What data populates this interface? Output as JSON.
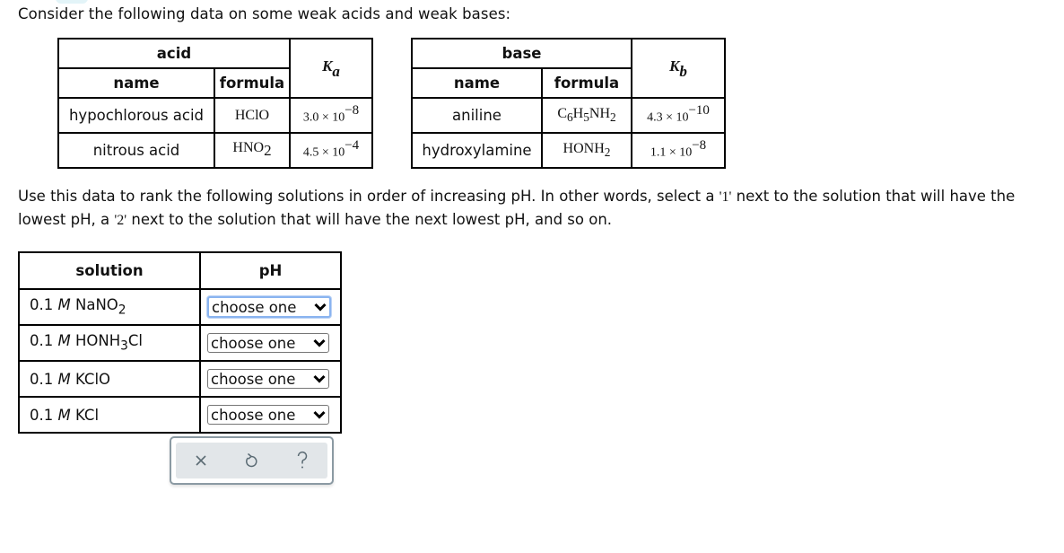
{
  "intro_text": "Consider the following data on some weak acids and weak bases:",
  "acid_table": {
    "group_header": "acid",
    "name_header": "name",
    "formula_header": "formula",
    "k_symbol": "K",
    "k_subscript": "a",
    "rows": [
      {
        "name": "hypochlorous acid",
        "formula": "HClO",
        "formula_sub": "",
        "k_mantissa": "3.0 × 10",
        "k_exponent": "−8"
      },
      {
        "name": "nitrous acid",
        "formula": "HNO",
        "formula_sub": "2",
        "k_mantissa": "4.5 × 10",
        "k_exponent": "−4"
      }
    ]
  },
  "base_table": {
    "group_header": "base",
    "name_header": "name",
    "formula_header": "formula",
    "k_symbol": "K",
    "k_subscript": "b",
    "rows": [
      {
        "name": "aniline",
        "formula_parts": [
          "C",
          "6",
          "H",
          "5",
          "NH",
          "2"
        ],
        "k_mantissa": "4.3 × 10",
        "k_exponent": "−10"
      },
      {
        "name": "hydroxylamine",
        "formula_parts": [
          "HONH",
          "2"
        ],
        "k_mantissa": "1.1 × 10",
        "k_exponent": "−8"
      }
    ]
  },
  "prompt": {
    "part1": "Use this data to rank the following solutions in order of increasing pH. In other words, select a ",
    "q1": "'1'",
    "part2": " next to the solution that will have the lowest pH, a ",
    "q2": "'2'",
    "part3": " next to the solution that will have the next lowest pH, and so on."
  },
  "solution_table": {
    "solution_header": "solution",
    "ph_header": "pH",
    "concentration": "0.1",
    "unit": "M",
    "rows": [
      {
        "compound": "NaNO",
        "sub": "2",
        "tail": "",
        "selected": "choose one",
        "focused": true
      },
      {
        "compound": "HONH",
        "sub": "3",
        "tail": "Cl",
        "selected": "choose one",
        "focused": false
      },
      {
        "compound": "KClO",
        "sub": "",
        "tail": "",
        "selected": "choose one",
        "focused": false
      },
      {
        "compound": "KCl",
        "sub": "",
        "tail": "",
        "selected": "choose one",
        "focused": false
      }
    ]
  },
  "toolbar": {
    "buttons": [
      {
        "icon": "close-icon",
        "label": "×"
      },
      {
        "icon": "undo-icon",
        "label": "↺"
      },
      {
        "icon": "help-icon",
        "label": "?"
      }
    ]
  },
  "colors": {
    "focus_ring": "#8ab4f0",
    "toolbar_bg": "#e2e6e9",
    "toolbar_border": "#8b9aa3",
    "icon_color": "#5a6a73"
  }
}
